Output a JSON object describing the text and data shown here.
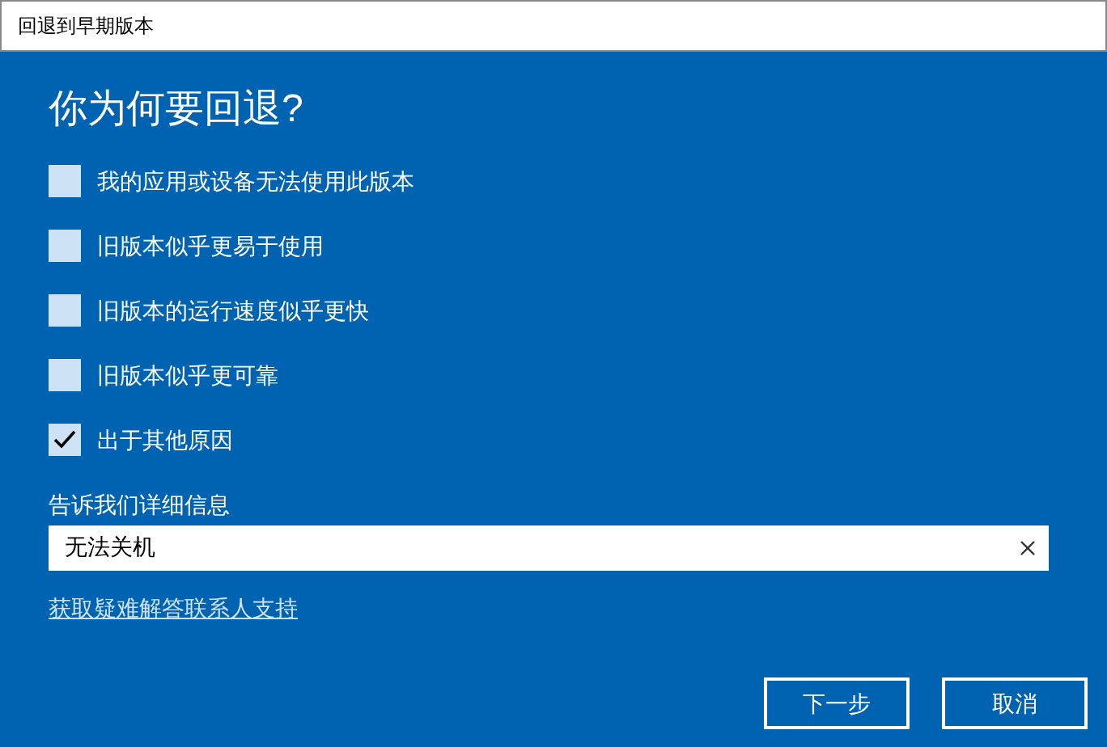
{
  "window": {
    "title": "回退到早期版本"
  },
  "heading": "你为何要回退?",
  "reasons": [
    {
      "label": "我的应用或设备无法使用此版本",
      "checked": false
    },
    {
      "label": "旧版本似乎更易于使用",
      "checked": false
    },
    {
      "label": "旧版本的运行速度似乎更快",
      "checked": false
    },
    {
      "label": "旧版本似乎更可靠",
      "checked": false
    },
    {
      "label": "出于其他原因",
      "checked": true
    }
  ],
  "details": {
    "label": "告诉我们详细信息",
    "value": "无法关机"
  },
  "support_link": "获取疑难解答联系人支持",
  "buttons": [
    "下一步",
    "取消"
  ]
}
